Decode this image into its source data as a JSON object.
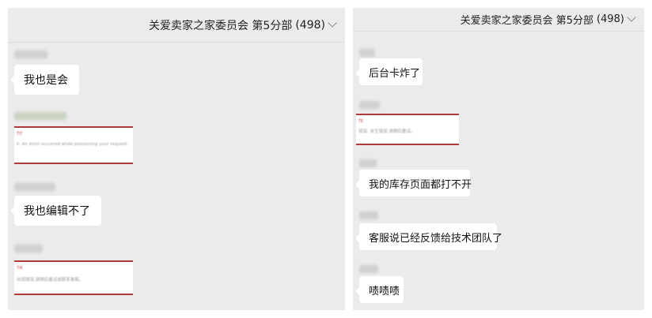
{
  "left_panel": {
    "header": {
      "title": "关爱卖家之家委员会 第5分部",
      "count": "(498)"
    },
    "messages": [
      {
        "type": "text",
        "text": "我也是会"
      },
      {
        "type": "image",
        "title": "TIT",
        "text": "k: An error occurred while processing your request."
      },
      {
        "type": "text",
        "text": "我也编辑不了"
      },
      {
        "type": "image",
        "title": "TiR",
        "text": "出现错误,请稍后重试或联系客服。"
      }
    ]
  },
  "right_panel": {
    "header": {
      "title": "关爱卖家之家委员会 第5分部",
      "count": "(498)"
    },
    "messages": [
      {
        "type": "text",
        "text": "后台卡炸了"
      },
      {
        "type": "image",
        "title": "TE",
        "text": "错误: 发生错误,请稍后重试。"
      },
      {
        "type": "text",
        "text": "我的库存页面都打不开"
      },
      {
        "type": "text",
        "text": "客服说已经反馈给技术团队了"
      },
      {
        "type": "text",
        "text": "啧啧啧"
      }
    ]
  },
  "icons": {
    "dropdown": "chevron-down-icon"
  }
}
